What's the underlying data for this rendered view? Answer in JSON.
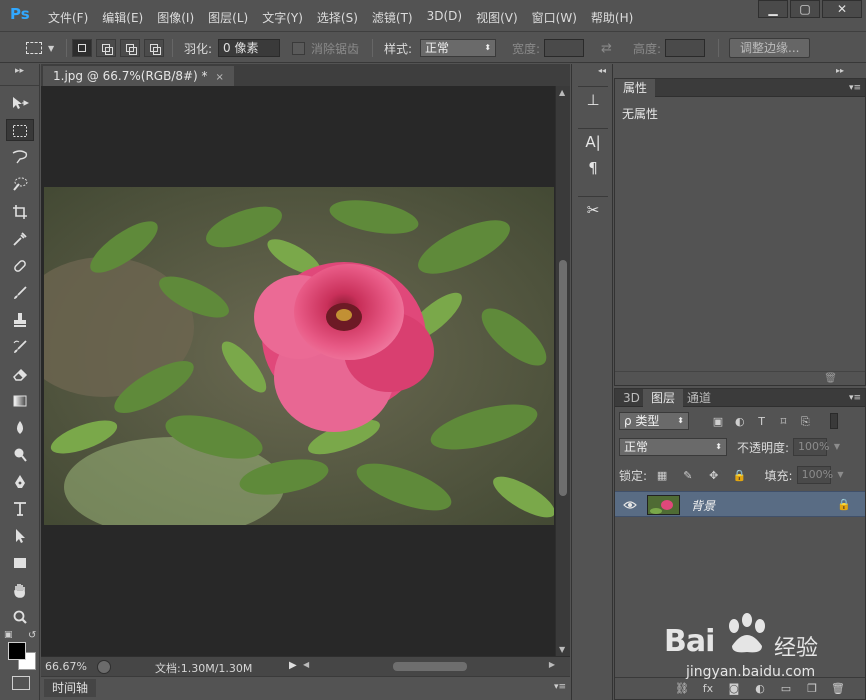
{
  "app": {
    "logo": "Ps"
  },
  "menu": [
    "文件(F)",
    "编辑(E)",
    "图像(I)",
    "图层(L)",
    "文字(Y)",
    "选择(S)",
    "滤镜(T)",
    "3D(D)",
    "视图(V)",
    "窗口(W)",
    "帮助(H)"
  ],
  "window": {
    "minimize": "▁",
    "restore": "▢",
    "close": "✕"
  },
  "options": {
    "feather_label": "羽化:",
    "feather_value": "0 像素",
    "antialias_label": "消除锯齿",
    "style_label": "样式:",
    "style_value": "正常",
    "width_label": "宽度:",
    "height_label": "高度:",
    "refine_button": "调整边缘..."
  },
  "document": {
    "tab_title": "1.jpg @ 66.7%(RGB/8#) *",
    "tab_close": "×",
    "zoom": "66.67%",
    "info": "文档:1.30M/1.30M"
  },
  "timeline": {
    "label": "时间轴"
  },
  "properties": {
    "tab": "属性",
    "empty_text": "无属性"
  },
  "layers": {
    "tabs": [
      "3D",
      "图层",
      "通道"
    ],
    "filter_label": "ρ 类型",
    "blend_mode": "正常",
    "opacity_label": "不透明度:",
    "opacity_value": "100%",
    "lock_label": "锁定:",
    "fill_label": "填充:",
    "fill_value": "100%",
    "layer_name": "背景"
  },
  "watermark": {
    "brand": "Bai",
    "brand_cn": "经验",
    "url": "jingyan.baidu.com"
  },
  "colors": {
    "accent": "#31a8ff",
    "selected_layer": "#596c84",
    "foreground": "#000000",
    "background": "#ffffff"
  }
}
